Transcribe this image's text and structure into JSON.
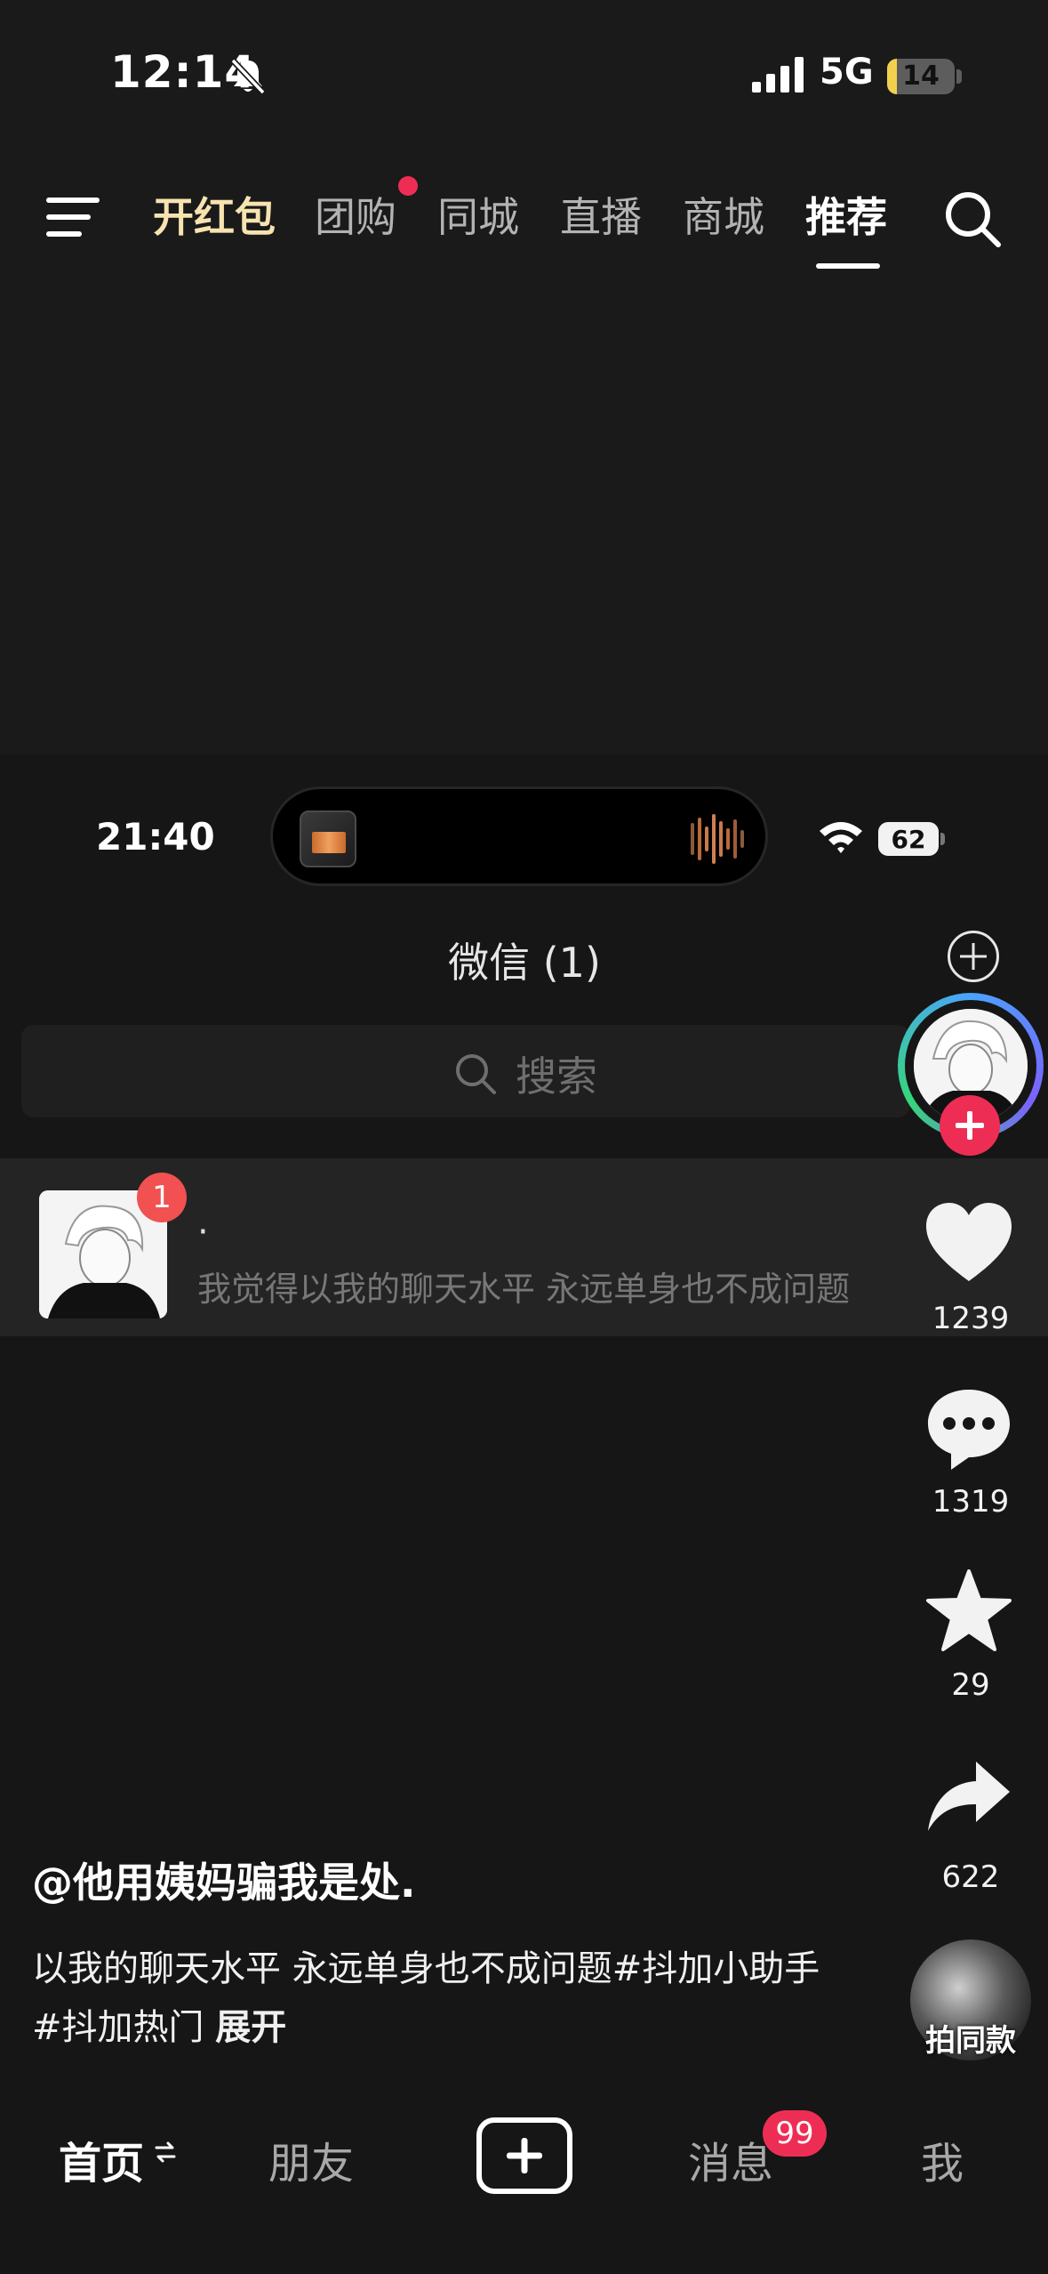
{
  "status_bar": {
    "time": "12:14",
    "network": "5G",
    "battery_percent": "14",
    "battery_level": 0.14
  },
  "top_nav": {
    "tabs": [
      {
        "label": "开红包"
      },
      {
        "label": "团购"
      },
      {
        "label": "同城"
      },
      {
        "label": "直播"
      },
      {
        "label": "商城"
      },
      {
        "label": "推荐"
      }
    ],
    "active_tab": "推荐"
  },
  "video_content": {
    "inner_time": "21:40",
    "inner_battery": "62",
    "wechat_title": "微信 (1)",
    "search_placeholder": "搜索",
    "chat": {
      "unread": "1",
      "name": "·",
      "last_message": "我觉得以我的聊天水平 永远单身也不成问题"
    }
  },
  "actions": {
    "likes": "1239",
    "comments": "1319",
    "favorites": "29",
    "shares": "622",
    "music_label": "拍同款"
  },
  "caption": {
    "author": "@他用姨妈骗我是处.",
    "text": "以我的聊天水平 永远单身也不成问题#抖加小助手 #抖加热门",
    "expand": "展开"
  },
  "bottom_nav": {
    "home": "首页",
    "friends": "朋友",
    "messages": "消息",
    "messages_badge": "99",
    "me": "我"
  },
  "colors": {
    "accent_red": "#ee2d55",
    "gold_tab": "#f7e3b0",
    "background": "#161616"
  }
}
